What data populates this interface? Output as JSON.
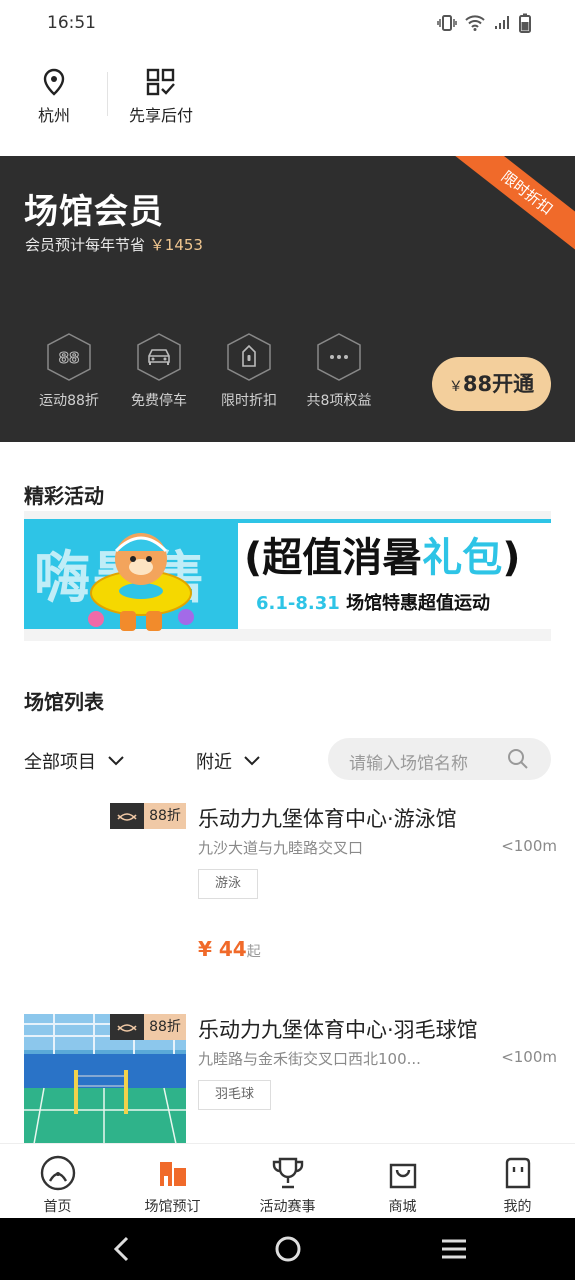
{
  "status_bar": {
    "time": "16:51"
  },
  "topbar": {
    "location": "杭州",
    "pay_later": "先享后付"
  },
  "member": {
    "title": "场馆会员",
    "subtitle_prefix": "会员预计每年节省",
    "saving": "￥1453",
    "ribbon": "限时折扣",
    "benefits": [
      {
        "label": "运动88折",
        "icon": "88-icon"
      },
      {
        "label": "免费停车",
        "icon": "car-icon"
      },
      {
        "label": "限时折扣",
        "icon": "tag-icon"
      },
      {
        "label": "共8项权益",
        "icon": "more-icon"
      }
    ],
    "open_button": {
      "currency": "￥",
      "label": "88开通"
    }
  },
  "activities": {
    "title": "精彩活动",
    "banner": {
      "left_text": "嗨暑售",
      "headline_a": "(超值消暑",
      "headline_b": "礼包",
      "headline_c": ")",
      "date": "6.1-8.31",
      "tagline": "场馆特惠超值运动"
    }
  },
  "venue_list": {
    "title": "场馆列表",
    "filter_all": "全部项目",
    "filter_nearby": "附近",
    "search_placeholder": "请输入场馆名称",
    "items": [
      {
        "discount": "88折",
        "name": "乐动力九堡体育中心·游泳馆",
        "address": "九沙大道与九睦路交叉口",
        "distance": "<100m",
        "tag": "游泳",
        "price_symbol": "¥",
        "price": "44",
        "price_suffix": "起"
      },
      {
        "discount": "88折",
        "name": "乐动力九堡体育中心·羽毛球馆",
        "address": "九睦路与金禾街交叉口西北100...",
        "distance": "<100m",
        "tag": "羽毛球"
      }
    ]
  },
  "bottom_nav": [
    {
      "label": "首页",
      "icon": "home-icon"
    },
    {
      "label": "场馆预订",
      "icon": "venue-icon"
    },
    {
      "label": "活动赛事",
      "icon": "trophy-icon"
    },
    {
      "label": "商城",
      "icon": "bag-icon"
    },
    {
      "label": "我的",
      "icon": "profile-icon"
    }
  ],
  "colors": {
    "accent": "#f06a2a",
    "gold": "#f3cf9c",
    "dark": "#2e2e2e",
    "banner_blue": "#2ec4e6"
  }
}
